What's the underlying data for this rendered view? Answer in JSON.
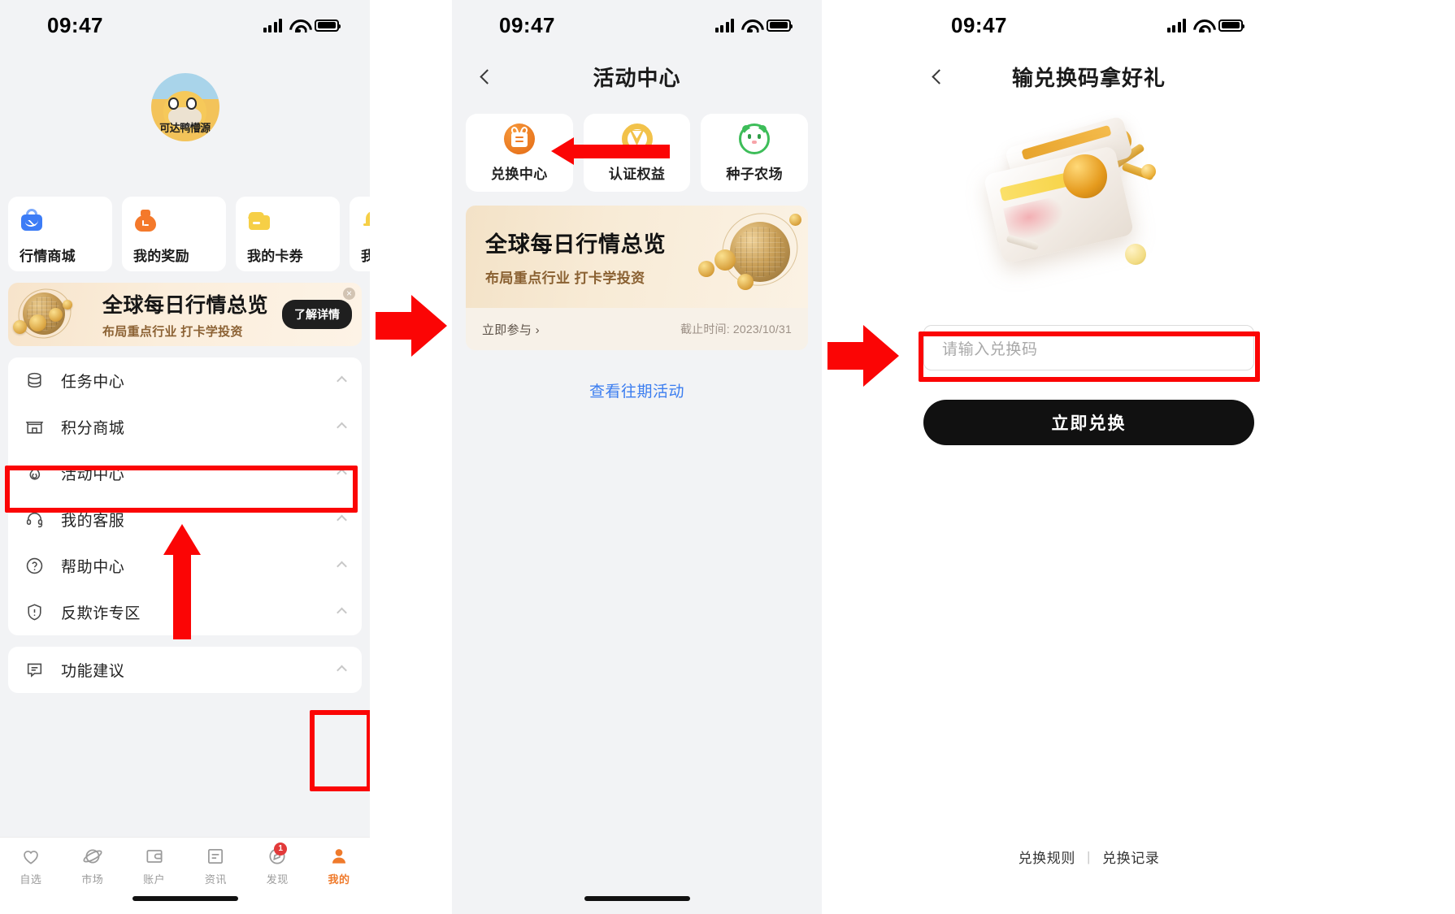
{
  "status": {
    "time": "09:47"
  },
  "panel1": {
    "avatar_label": "可达鸭懵源",
    "quick_cards": [
      {
        "label": "行情商城",
        "icon": "shopping-bag-icon"
      },
      {
        "label": "我的奖励",
        "icon": "money-bag-icon"
      },
      {
        "label": "我的卡券",
        "icon": "wallet-icon"
      },
      {
        "label": "我的提",
        "icon": "bell-icon"
      }
    ],
    "promo": {
      "title": "全球每日行情总览",
      "subtitle": "布局重点行业 打卡学投资",
      "button": "了解详情",
      "close": "×"
    },
    "menu_group_1": [
      {
        "label": "任务中心",
        "icon": "database-icon"
      },
      {
        "label": "积分商城",
        "icon": "store-icon"
      },
      {
        "label": "活动中心",
        "icon": "flame-icon",
        "highlighted": true
      },
      {
        "label": "我的客服",
        "icon": "headset-icon"
      },
      {
        "label": "帮助中心",
        "icon": "question-circle-icon"
      },
      {
        "label": "反欺诈专区",
        "icon": "shield-alert-icon"
      }
    ],
    "menu_group_2": [
      {
        "label": "功能建议",
        "icon": "message-icon"
      }
    ],
    "tabs": [
      {
        "label": "自选",
        "icon": "heart-icon",
        "active": false,
        "badge": ""
      },
      {
        "label": "市场",
        "icon": "planet-icon",
        "active": false,
        "badge": ""
      },
      {
        "label": "账户",
        "icon": "wallet-outline-icon",
        "active": false,
        "badge": ""
      },
      {
        "label": "资讯",
        "icon": "news-icon",
        "active": false,
        "badge": ""
      },
      {
        "label": "发现",
        "icon": "compass-icon",
        "active": false,
        "badge": "1"
      },
      {
        "label": "我的",
        "icon": "person-icon",
        "active": true,
        "badge": ""
      }
    ]
  },
  "panel2": {
    "nav_title": "活动中心",
    "cards": [
      {
        "label": "兑换中心",
        "icon": "gift-circle-icon"
      },
      {
        "label": "认证权益",
        "icon": "badge-circle-icon"
      },
      {
        "label": "种子农场",
        "icon": "seed-farm-icon"
      }
    ],
    "banner": {
      "title": "全球每日行情总览",
      "subtitle": "布局重点行业 打卡学投资",
      "join": "立即参与 ›",
      "deadline": "截止时间: 2023/10/31"
    },
    "past_activities_link": "查看往期活动"
  },
  "panel3": {
    "nav_title": "输兑换码拿好礼",
    "input_placeholder": "请输入兑换码",
    "submit_label": "立即兑换",
    "footer_links": [
      "兑换规则",
      "兑换记录"
    ],
    "footer_sep": "|"
  },
  "colors": {
    "highlight": "#fb0505",
    "accent_orange": "#ef7a2b",
    "link_blue": "#3b7df0",
    "page_bg": "#f2f3f5"
  }
}
